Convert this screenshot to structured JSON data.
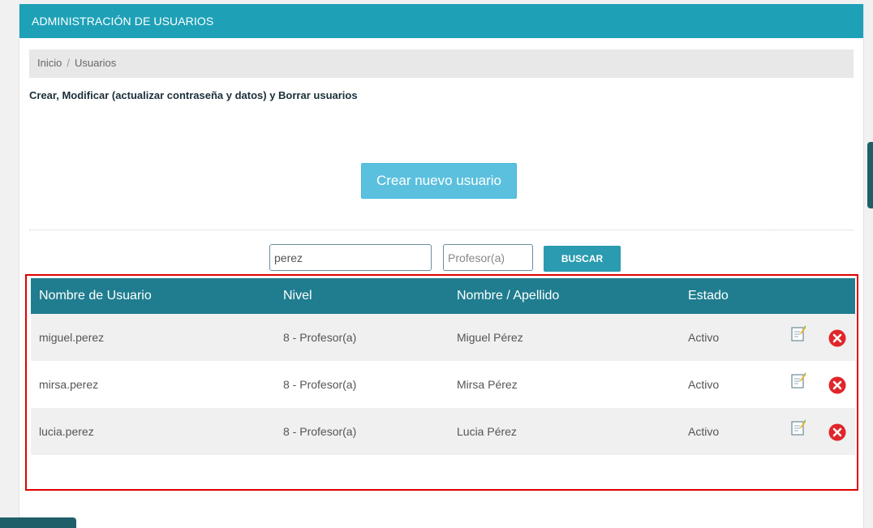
{
  "header": {
    "title": "ADMINISTRACIÓN DE USUARIOS"
  },
  "breadcrumb": {
    "home": "Inicio",
    "current": "Usuarios",
    "separator": "/"
  },
  "description": "Crear, Modificar (actualizar contraseña y datos) y Borrar usuarios",
  "create_button": "Crear nuevo usuario",
  "search": {
    "value": "perez",
    "level_placeholder": "Profesor(a)",
    "button": "BUSCAR"
  },
  "table": {
    "headers": [
      "Nombre de Usuario",
      "Nivel",
      "Nombre / Apellido",
      "Estado"
    ],
    "rows": [
      {
        "username": "miguel.perez",
        "level": "8 - Profesor(a)",
        "name": "Miguel Pérez",
        "status": "Activo"
      },
      {
        "username": "mirsa.perez",
        "level": "8 - Profesor(a)",
        "name": "Mirsa Pérez",
        "status": "Activo"
      },
      {
        "username": "lucia.perez",
        "level": "8 - Profesor(a)",
        "name": "Lucia Pérez",
        "status": "Activo"
      }
    ]
  },
  "colors": {
    "header": "#1ea1b7",
    "table_header": "#1f7d8f",
    "highlight": "#e00000",
    "create": "#5bc0de"
  },
  "icons": {
    "edit": "edit-note-icon",
    "delete": "delete-x-icon"
  }
}
